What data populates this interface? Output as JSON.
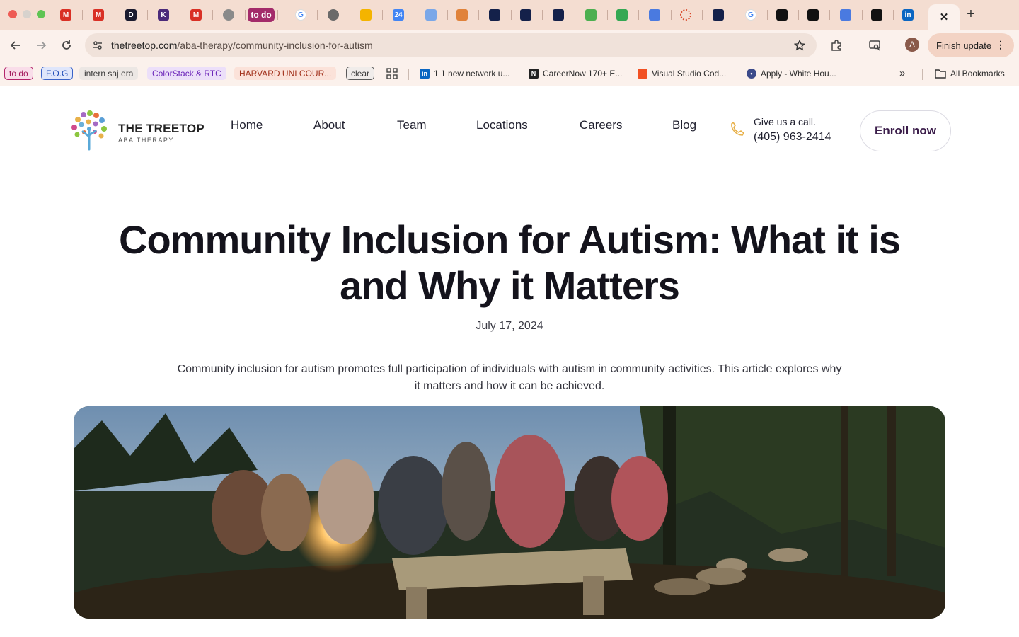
{
  "browser": {
    "tabs": [
      {
        "icon": "gmail-icon",
        "label": "M",
        "color": "#d93025"
      },
      {
        "icon": "gmail-icon",
        "label": "M",
        "color": "#d93025"
      },
      {
        "icon": "d-app-icon",
        "label": "D",
        "color": "#1a1a2e"
      },
      {
        "icon": "k-app-icon",
        "label": "K",
        "color": "#4b2a7a"
      },
      {
        "icon": "gmail-icon",
        "label": "M",
        "color": "#d93025"
      },
      {
        "icon": "globe-icon",
        "label": "",
        "color": "#8a8a8a"
      },
      {
        "icon": "todo-chip-icon",
        "label": "to do",
        "color": "#a32b6a"
      },
      {
        "icon": "google-icon",
        "label": "G",
        "color": "#4285f4"
      },
      {
        "icon": "globe-icon",
        "label": "",
        "color": "#6a6a6a"
      },
      {
        "icon": "keep-icon",
        "label": "",
        "color": "#f4b400"
      },
      {
        "icon": "calendar-icon",
        "label": "24",
        "color": "#4285f4"
      },
      {
        "icon": "classroom-icon",
        "label": "",
        "color": "#7aa7e8"
      },
      {
        "icon": "chrome-color-icon",
        "label": "",
        "color": "#e0823a"
      },
      {
        "icon": "night-sky-icon",
        "label": "",
        "color": "#14214a"
      },
      {
        "icon": "night-sky-icon",
        "label": "",
        "color": "#14214a"
      },
      {
        "icon": "night-sky-icon",
        "label": "",
        "color": "#14214a"
      },
      {
        "icon": "green-star-icon",
        "label": "",
        "color": "#4caf50"
      },
      {
        "icon": "drive-icon",
        "label": "",
        "color": "#34a853"
      },
      {
        "icon": "docs-icon",
        "label": "",
        "color": "#4a7ae0"
      },
      {
        "icon": "ring-icon",
        "label": "",
        "color": "#d9482b"
      },
      {
        "icon": "night-sky-icon",
        "label": "",
        "color": "#14214a"
      },
      {
        "icon": "google-icon",
        "label": "G",
        "color": "#4285f4"
      },
      {
        "icon": "cursor-icon",
        "label": "",
        "color": "#111111"
      },
      {
        "icon": "cursor-icon",
        "label": "",
        "color": "#111111"
      },
      {
        "icon": "docs-icon",
        "label": "",
        "color": "#4a7ae0"
      },
      {
        "icon": "github-icon",
        "label": "",
        "color": "#111111"
      },
      {
        "icon": "linkedin-icon",
        "label": "in",
        "color": "#0a66c2"
      }
    ],
    "address": {
      "domain": "thetreetop.com",
      "path": "/aba-therapy/community-inclusion-for-autism"
    },
    "finish_update": "Finish update",
    "avatar_letter": "A",
    "bookmarks": {
      "chips": [
        {
          "label": "to do",
          "bg": "#f9dde9",
          "fg": "#a3185a",
          "border": "#b3246a"
        },
        {
          "label": "F.O.G",
          "bg": "#dfe6fb",
          "fg": "#1a48b5",
          "border": "#3a63c9"
        },
        {
          "label": "intern saj era",
          "bg": "#ece7e4",
          "fg": "#3a3a3a",
          "border": "#ece7e4"
        },
        {
          "label": "ColorStack & RTC",
          "bg": "#ecdff9",
          "fg": "#6a22b8",
          "border": "#ecdff9"
        },
        {
          "label": "HARVARD UNI COUR...",
          "bg": "#fbe2d9",
          "fg": "#a1301a",
          "border": "#fbe2d9"
        },
        {
          "label": "clear",
          "bg": "#f0ecea",
          "fg": "#3a3a3a",
          "border": "#5a5a5a"
        }
      ],
      "links": [
        {
          "label": "1 1 new network u...",
          "icon": "linkedin-icon",
          "color": "#0a66c2"
        },
        {
          "label": "CareerNow 170+ E...",
          "icon": "n-app-icon",
          "color": "#222222"
        },
        {
          "label": "Visual Studio Cod...",
          "icon": "microsoft-icon",
          "color": "#f25022"
        },
        {
          "label": "Apply - White Hou...",
          "icon": "seal-icon",
          "color": "#3b4a8a"
        }
      ],
      "all_bookmarks": "All Bookmarks"
    }
  },
  "site": {
    "logo_name": "THE TREETOP",
    "logo_sub": "ABA THERAPY",
    "nav": [
      "Home",
      "About",
      "Team",
      "Locations",
      "Careers",
      "Blog"
    ],
    "call_label": "Give us a call.",
    "call_number": "(405) 963-2414",
    "enroll": "Enroll now",
    "accent": "#e8b14a",
    "button_text_color": "#3b1d4a"
  },
  "article": {
    "title": "Community Inclusion for Autism: What it is and Why it Matters",
    "date": "July 17, 2024",
    "lede": "Community inclusion for autism promotes full participation of individuals with autism in community activities. This article explores why it matters and how it can be achieved.",
    "hero_image": "campfire-gathering-photo"
  }
}
